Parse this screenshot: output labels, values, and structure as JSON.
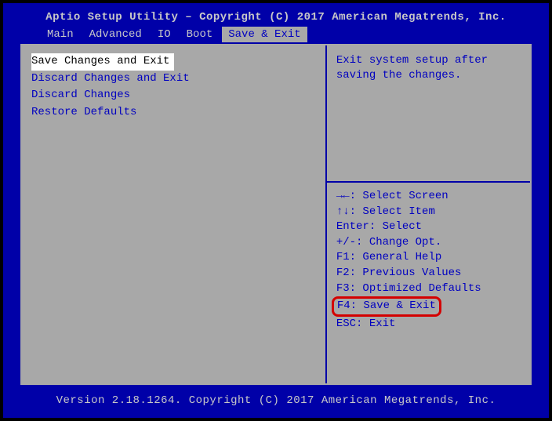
{
  "header": "Aptio Setup Utility – Copyright (C) 2017 American Megatrends, Inc.",
  "tabs": [
    {
      "label": "Main",
      "active": false
    },
    {
      "label": "Advanced",
      "active": false
    },
    {
      "label": "IO",
      "active": false
    },
    {
      "label": "Boot",
      "active": false
    },
    {
      "label": "Save & Exit",
      "active": true
    }
  ],
  "menu": [
    {
      "label": "Save Changes and Exit",
      "selected": true
    },
    {
      "label": "Discard Changes and Exit",
      "selected": false
    },
    {
      "label": "Discard Changes",
      "selected": false
    },
    {
      "label": "Restore Defaults",
      "selected": false
    }
  ],
  "help_desc": "Exit system setup after saving the changes.",
  "key_help": [
    {
      "text": "→←: Select Screen",
      "highlight": false
    },
    {
      "text": "↑↓: Select Item",
      "highlight": false
    },
    {
      "text": "Enter: Select",
      "highlight": false
    },
    {
      "text": "+/-: Change Opt.",
      "highlight": false
    },
    {
      "text": "F1: General Help",
      "highlight": false
    },
    {
      "text": "F2: Previous Values",
      "highlight": false
    },
    {
      "text": "F3: Optimized Defaults",
      "highlight": false
    },
    {
      "text": "F4: Save & Exit",
      "highlight": true
    },
    {
      "text": "ESC: Exit",
      "highlight": false
    }
  ],
  "footer": "Version 2.18.1264. Copyright (C) 2017 American Megatrends, Inc."
}
